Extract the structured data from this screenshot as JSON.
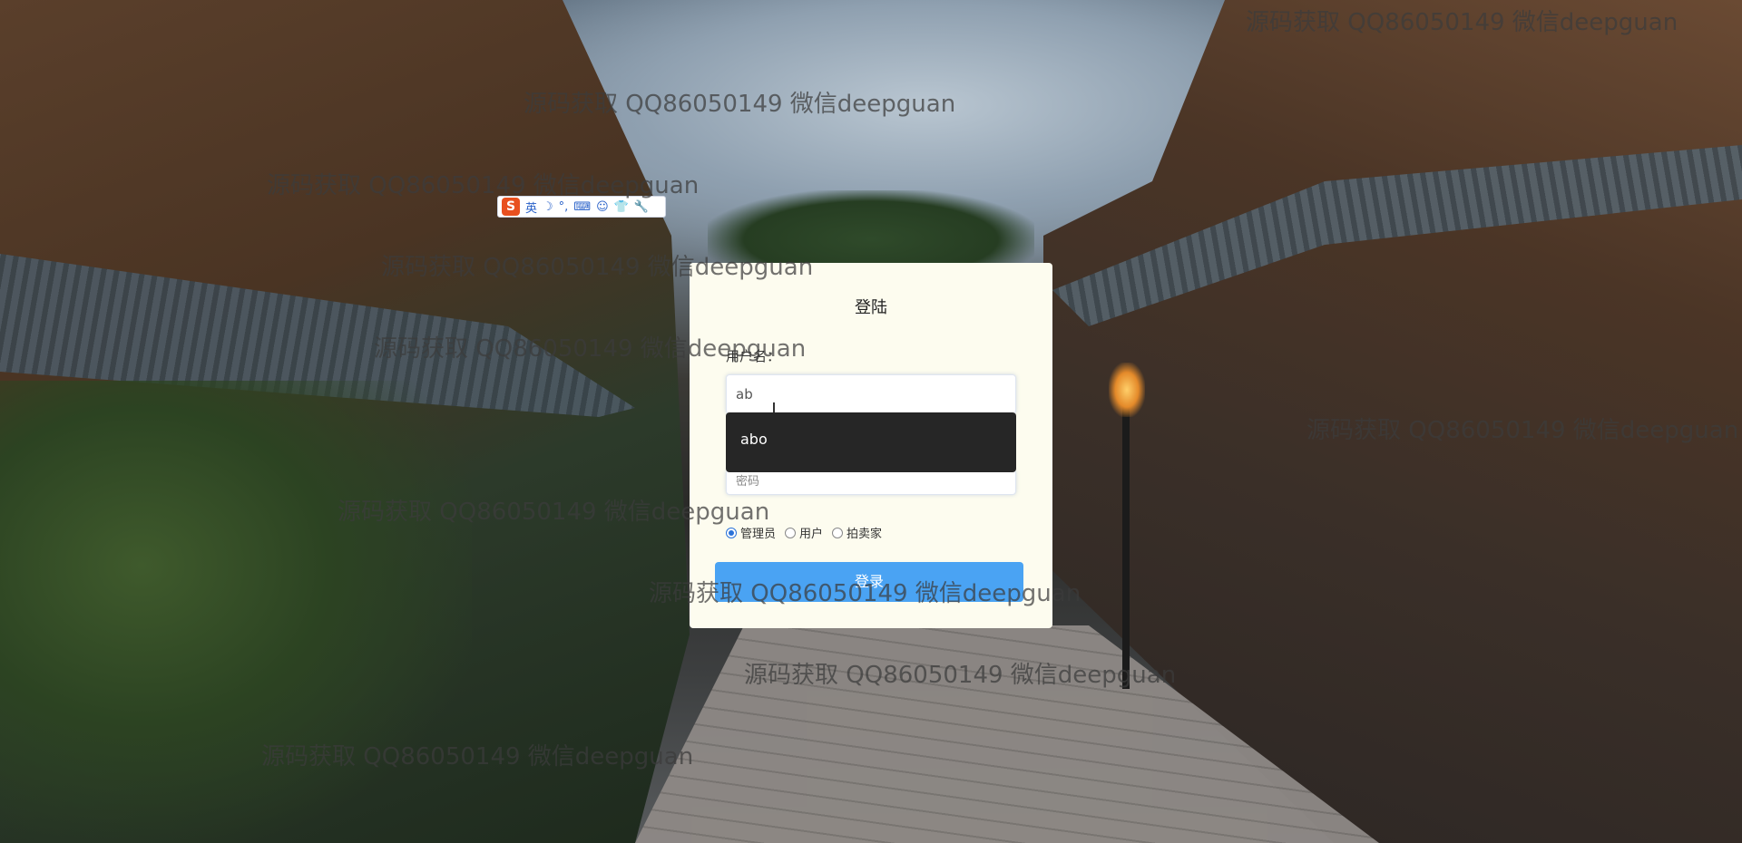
{
  "ime_bar": {
    "logo": "S",
    "mode": "英",
    "items": [
      "☽",
      "°,",
      "⌨",
      "☺",
      "👕",
      "🔧"
    ]
  },
  "login": {
    "title": "登陆",
    "username_label": "用户名：",
    "username_value": "ab",
    "autocomplete_suggestion": "abo",
    "password_placeholder": "密码",
    "roles": [
      {
        "label": "管理员",
        "checked": true
      },
      {
        "label": "用户",
        "checked": false
      },
      {
        "label": "拍卖家",
        "checked": false
      }
    ],
    "submit_label": "登录"
  },
  "watermark_text": "源码获取 QQ86050149 微信deepguan",
  "colors": {
    "card_bg": "#fdfcef",
    "button_bg": "#4aa3f3",
    "autocomplete_bg": "#262626"
  }
}
